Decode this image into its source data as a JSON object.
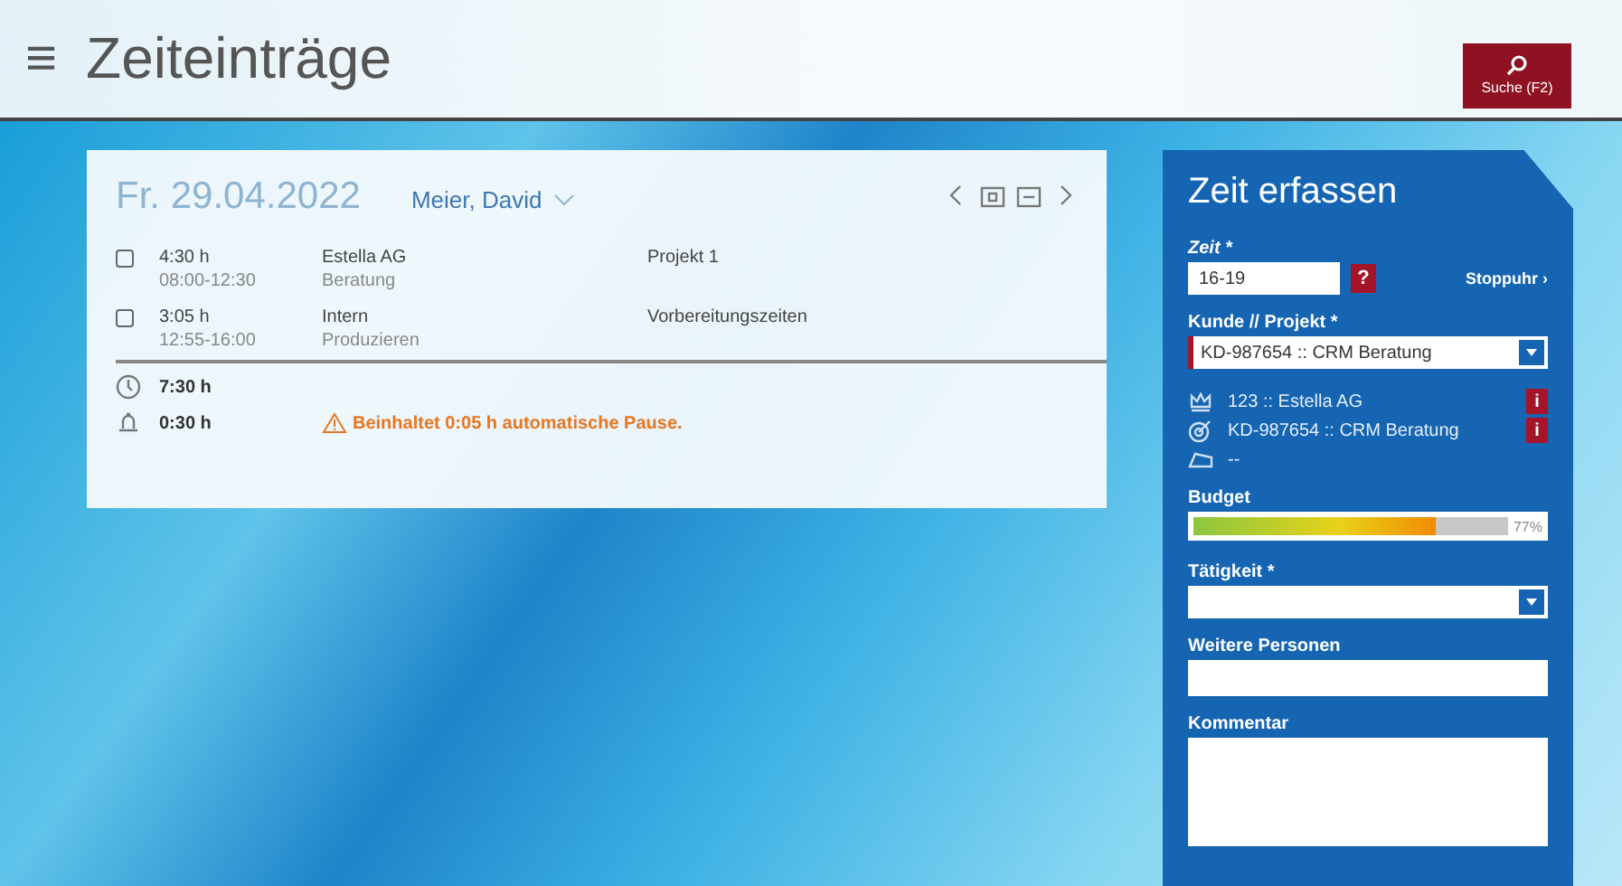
{
  "header": {
    "menu_icon": "≡",
    "title": "Zeiteinträge",
    "search_button": "Suche (F2)"
  },
  "day": {
    "date": "Fr. 29.04.2022",
    "person": "Meier, David",
    "entries": [
      {
        "checked": false,
        "duration": "4:30 h",
        "range": "08:00-12:30",
        "customer": "Estella AG",
        "activity": "Beratung",
        "project": "Projekt 1"
      },
      {
        "checked": false,
        "duration": "3:05 h",
        "range": "12:55-16:00",
        "customer": "Intern",
        "activity": "Produzieren",
        "project": "Vorbereitungszeiten"
      }
    ],
    "total": "7:30 h",
    "pause": "0:30 h",
    "warning": "Beinhaltet 0:05 h automatische Pause."
  },
  "form": {
    "title": "Zeit erfassen",
    "time_label": "Zeit *",
    "time_value": "16-19",
    "help": "?",
    "stopwatch": "Stoppuhr ›",
    "project_label": "Kunde // Projekt *",
    "project_value": "KD-987654 :: CRM Beratung",
    "details": [
      {
        "kind": "customer",
        "text": "123 :: Estella AG",
        "info": "i"
      },
      {
        "kind": "project",
        "text": "KD-987654 :: CRM Beratung",
        "info": "i"
      },
      {
        "kind": "task",
        "text": "--"
      }
    ],
    "budget_label": "Budget",
    "budget": {
      "level": 0.77,
      "reading": "77%"
    },
    "activity_label": "Tätigkeit *",
    "persons_label": "Weitere Personen",
    "comment_label": "Kommentar"
  }
}
